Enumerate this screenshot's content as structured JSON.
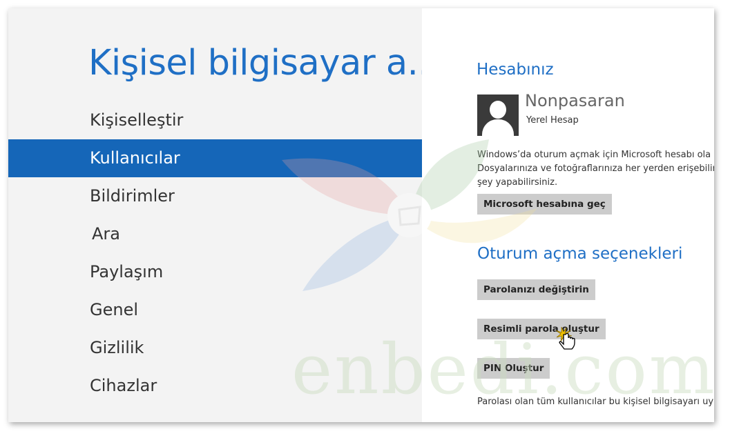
{
  "page_title": "Kişisel bilgisayar a...",
  "nav_items": [
    {
      "label": "Kişiselleştir"
    },
    {
      "label": "Kullanıcılar"
    },
    {
      "label": "Bildirimler"
    },
    {
      "label": "Ara"
    },
    {
      "label": "Paylaşım"
    },
    {
      "label": "Genel"
    },
    {
      "label": "Gizlilik"
    },
    {
      "label": "Cihazlar"
    }
  ],
  "active_nav": "Kullanıcılar",
  "account": {
    "section_title": "Hesabınız",
    "user_name": "Nonpasaran",
    "account_type": "Yerel Hesap",
    "description": "Windows’da oturum açmak için Microsoft hesabı ola\nDosyalarınıza ve fotoğraflarınıza her yerden erişebilir,\nşey yapabilirsiniz.",
    "switch_button": "Microsoft hesabına geç"
  },
  "signin_options": {
    "section_title": "Oturum açma seçenekleri",
    "change_password_button": "Parolanızı değiştirin",
    "picture_password_button": "Resimli parola oluştur",
    "pin_button": "PIN Oluştur",
    "note": "Parolası olan tüm kullanıcılar bu kişisel bilgisayarı uy"
  },
  "watermark_text": "enbedi.com",
  "colors": {
    "accent": "#1f6fc5",
    "active_nav_bg": "#1566b8",
    "button_bg": "#cccccc",
    "left_pane_bg": "#f3f3f3"
  }
}
